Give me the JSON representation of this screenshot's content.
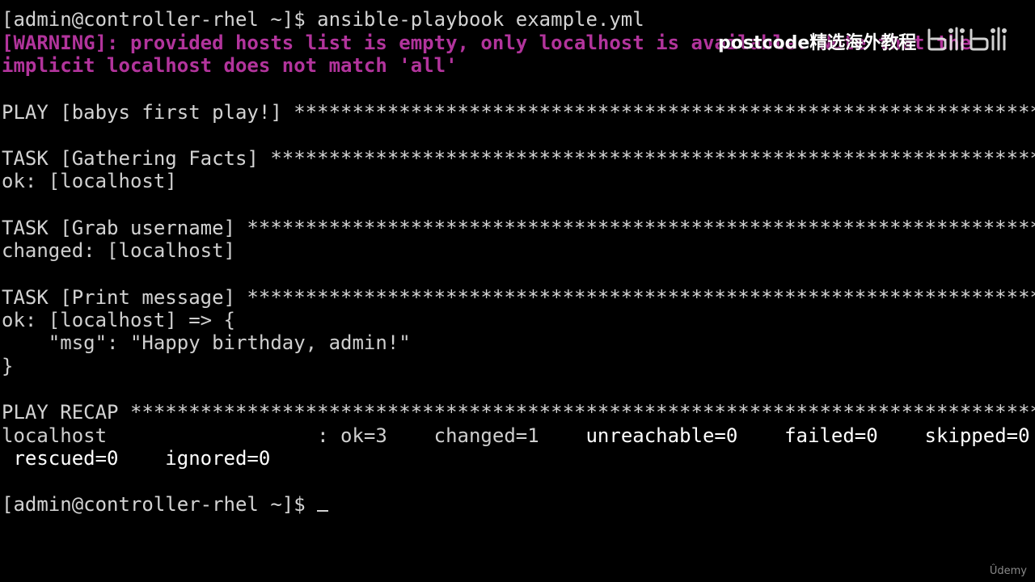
{
  "terminal": {
    "lines": {
      "prompt_cmd": "[admin@controller-rhel ~]$ ansible-playbook example.yml",
      "warning_1": "[WARNING]: provided hosts list is empty, only localhost is available. Note that the",
      "warning_2": "implicit localhost does not match 'all'",
      "play": "PLAY [babys first play!] *******************************************************************",
      "task_facts": "TASK [Gathering Facts] *********************************************************************",
      "ok_facts": "ok: [localhost]",
      "task_username": "TASK [Grab username] ***********************************************************************",
      "changed_username": "changed: [localhost]",
      "task_print": "TASK [Print message] ***********************************************************************",
      "ok_print": "ok: [localhost] => {",
      "msg": "    \"msg\": \"Happy birthday, admin!\"",
      "close_brace": "}",
      "recap": "PLAY RECAP *********************************************************************************",
      "recap_host": "localhost",
      "recap_colon": "                  : ",
      "recap_ok": "ok=3",
      "recap_changed": "    changed=1",
      "recap_rest": "    unreachable=0    failed=0    skipped=0",
      "recap_line2": " rescued=0    ignored=0",
      "final_prompt": "[admin@controller-rhel ~]$ "
    }
  },
  "watermark": {
    "text": "postcode精选海外教程",
    "logo_icon": "bilibili-logo-icon"
  },
  "brand": {
    "udemy": "Ûdemy"
  },
  "colors": {
    "background": "#000000",
    "foreground": "#d3d3d3",
    "warning": "#b2349c"
  }
}
